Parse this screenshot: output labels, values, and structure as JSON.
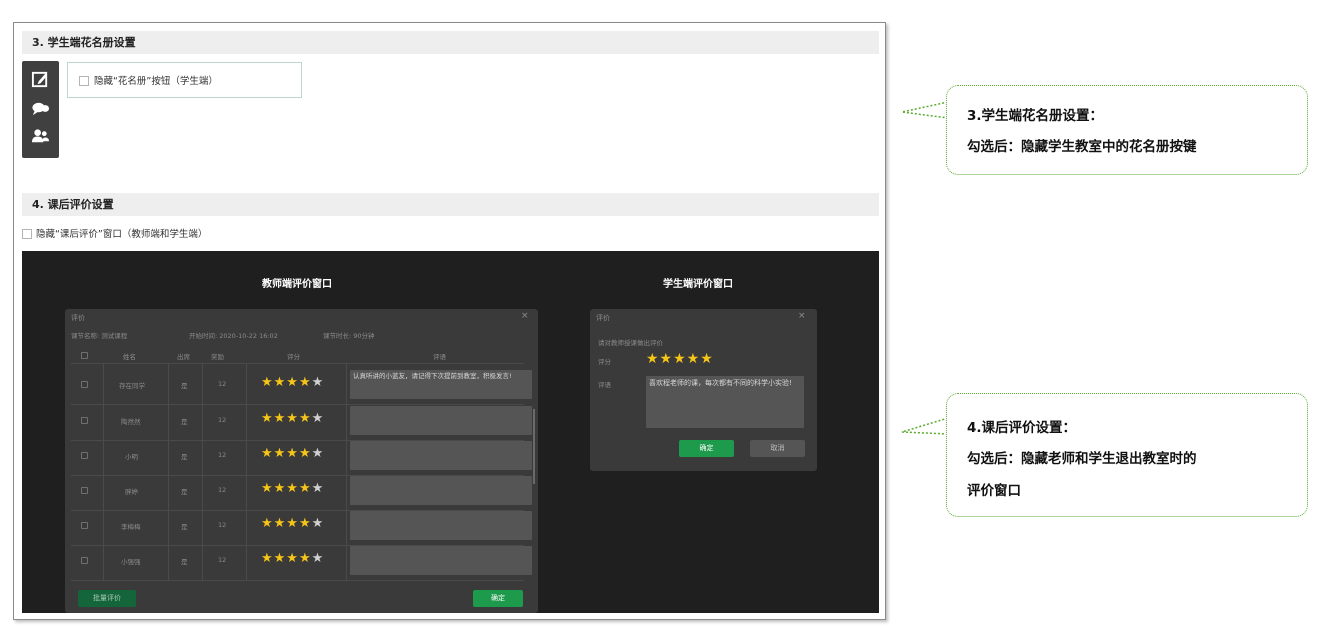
{
  "section3": {
    "title": "3. 学生端花名册设置",
    "option_label": "隐藏“花名册”按钮（学生端）"
  },
  "section4": {
    "title": "4. 课后评价设置",
    "option_label": "隐藏“课后评价”窗口（教师端和学生端）"
  },
  "toolbar_icons": [
    "edit-icon",
    "chat-icon",
    "users-icon"
  ],
  "preview": {
    "teacher_window_title": "教师端评价窗口",
    "student_window_title": "学生端评价窗口",
    "teacher_dialog": {
      "title": "评价",
      "close": "×",
      "info": {
        "lesson": "课节名称: 测试课程",
        "start": "开始时间: 2020-10-22 16:02",
        "duration": "课节时长: 90分钟"
      },
      "headers": [
        "姓名",
        "出席",
        "奖励",
        "评分",
        "评语"
      ],
      "rows": [
        {
          "name": "存在同学",
          "attend": "是",
          "reward": "12",
          "stars": 4,
          "comment": "认真听讲的小蓝友，请记得下次提前到教室，积极发言!"
        },
        {
          "name": "陶然然",
          "attend": "是",
          "reward": "12",
          "stars": 4,
          "comment": ""
        },
        {
          "name": "小明",
          "attend": "是",
          "reward": "12",
          "stars": 4,
          "comment": ""
        },
        {
          "name": "胖婷",
          "attend": "是",
          "reward": "12",
          "stars": 4,
          "comment": ""
        },
        {
          "name": "李梅梅",
          "attend": "是",
          "reward": "12",
          "stars": 4,
          "comment": ""
        },
        {
          "name": "小强强",
          "attend": "是",
          "reward": "12",
          "stars": 4,
          "comment": ""
        }
      ],
      "batch_button": "批量评价",
      "confirm_button": "确定"
    },
    "student_dialog": {
      "title": "评价",
      "close": "×",
      "prompt": "请对教师授课做出评价",
      "score_label": "评分",
      "stars": 5,
      "comment_label": "评语",
      "comment": "喜欢程老师的课，每次都有不同的科学小实验!",
      "confirm_button": "确定",
      "cancel_button": "取消"
    },
    "colors": {
      "green": "#1e9a4c",
      "star": "#f5c518",
      "callout_border": "#5aaa2e"
    }
  },
  "callouts": [
    {
      "line1": "3.学生端花名册设置：",
      "line2": "勾选后：隐藏学生教室中的花名册按键"
    },
    {
      "line1": "4.课后评价设置：",
      "line2": "勾选后：隐藏老师和学生退出教室时的",
      "line3": "评价窗口"
    }
  ]
}
